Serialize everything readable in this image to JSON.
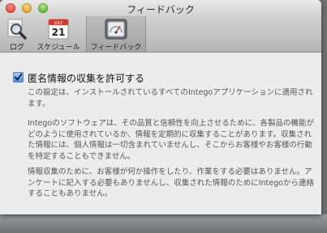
{
  "window": {
    "title": "フィードバック"
  },
  "toolbar": {
    "tabs": [
      {
        "label": "ログ",
        "icon": "magnifier-icon"
      },
      {
        "label": "スケジュール",
        "icon": "calendar-icon",
        "calendar_month": "JULY",
        "calendar_day": "21"
      },
      {
        "label": "フィードバック",
        "icon": "feedback-gauge-icon"
      }
    ],
    "selected_tab": "フィードバック"
  },
  "content": {
    "checkbox_label": "匿名情報の収集を許可する",
    "checkbox_checked": true,
    "paragraphs": [
      "この設定は、インストールされているすべてのIntegoアプリケーションに適用されます。",
      "Integoのソフトウェアは、その品質と信頼性を向上させるために、各製品の機能がどのように使用されているか、情報を定期的に収集することがあります。収集された情報には、個人情報は一切含まれていませんし、そこからお客様やお客様の行動を特定することもできません。",
      "情報収集のために、お客様が何か操作をしたり、作業をする必要はありません。アンケートに記入する必要もありませんし、収集された情報のためにIntegoから連絡することもありません。"
    ]
  },
  "colors": {
    "close": "#e2443a",
    "minimize": "#e0a128",
    "zoom": "#5cb53b",
    "checkbox": "#4d8fe0"
  }
}
